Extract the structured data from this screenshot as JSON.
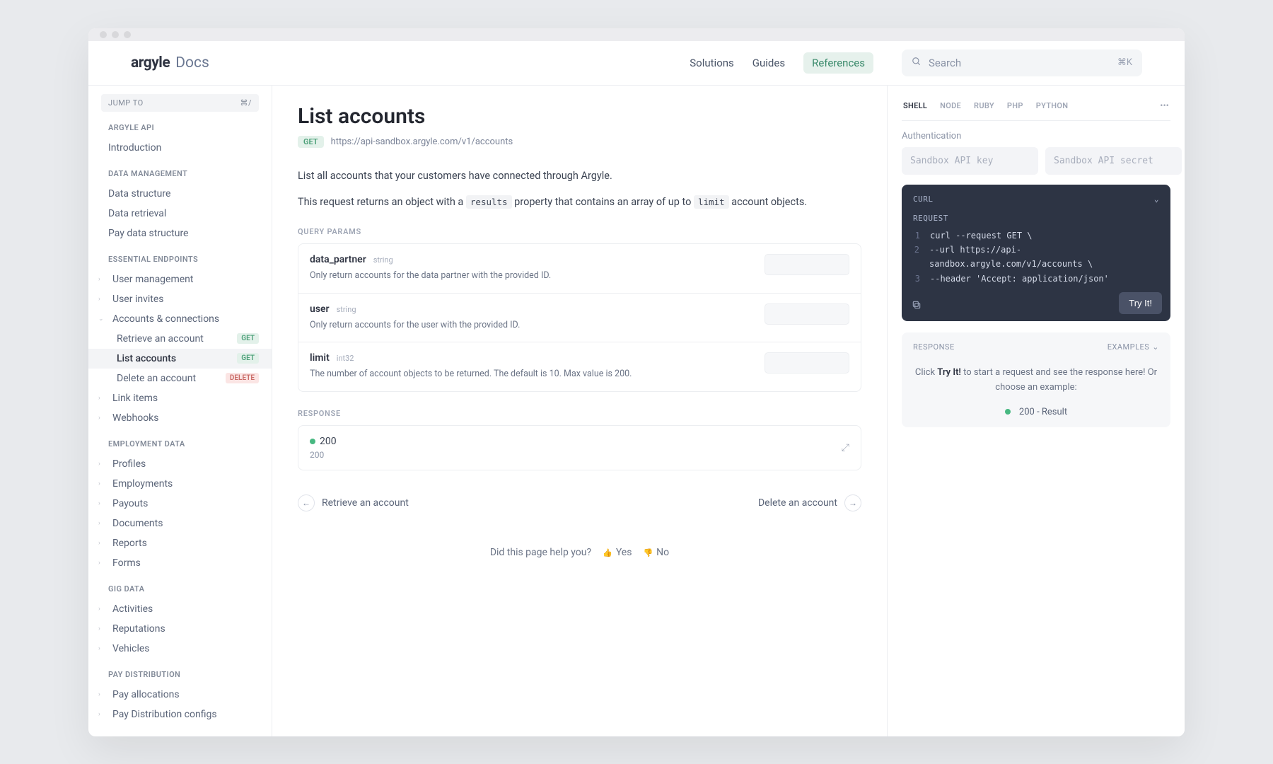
{
  "header": {
    "logo_brand": "argyle",
    "logo_docs": "Docs",
    "nav": [
      "Solutions",
      "Guides",
      "References"
    ],
    "active_nav": 2,
    "search_placeholder": "Search",
    "search_kbd": "⌘K"
  },
  "sidebar": {
    "jump": {
      "label": "JUMP TO",
      "shortcut": "⌘/"
    },
    "sections": [
      {
        "heading": "ARGYLE API",
        "items": [
          {
            "label": "Introduction"
          }
        ]
      },
      {
        "heading": "DATA MANAGEMENT",
        "items": [
          {
            "label": "Data structure"
          },
          {
            "label": "Data retrieval"
          },
          {
            "label": "Pay data structure"
          }
        ]
      },
      {
        "heading": "ESSENTIAL ENDPOINTS",
        "items": [
          {
            "label": "User management",
            "caret": "›"
          },
          {
            "label": "User invites",
            "caret": "›"
          },
          {
            "label": "Accounts & connections",
            "caret": "⌄",
            "children": [
              {
                "label": "Retrieve an account",
                "badge": "GET",
                "badge_kind": "get"
              },
              {
                "label": "List accounts",
                "badge": "GET",
                "badge_kind": "get",
                "active": true
              },
              {
                "label": "Delete an account",
                "badge": "DELETE",
                "badge_kind": "del"
              }
            ]
          },
          {
            "label": "Link items",
            "caret": "›"
          },
          {
            "label": "Webhooks",
            "caret": "›"
          }
        ]
      },
      {
        "heading": "EMPLOYMENT DATA",
        "items": [
          {
            "label": "Profiles",
            "caret": "›"
          },
          {
            "label": "Employments",
            "caret": "›"
          },
          {
            "label": "Payouts",
            "caret": "›"
          },
          {
            "label": "Documents",
            "caret": "›"
          },
          {
            "label": "Reports",
            "caret": "›"
          },
          {
            "label": "Forms",
            "caret": "›"
          }
        ]
      },
      {
        "heading": "GIG DATA",
        "items": [
          {
            "label": "Activities",
            "caret": "›"
          },
          {
            "label": "Reputations",
            "caret": "›"
          },
          {
            "label": "Vehicles",
            "caret": "›"
          }
        ]
      },
      {
        "heading": "PAY DISTRIBUTION",
        "items": [
          {
            "label": "Pay allocations",
            "caret": "›"
          },
          {
            "label": "Pay Distribution configs",
            "caret": "›"
          }
        ]
      }
    ]
  },
  "content": {
    "title": "List accounts",
    "method": "GET",
    "url": "https://api-sandbox.argyle.com/v1/accounts",
    "p1": "List all accounts that your customers have connected through Argyle.",
    "p2_a": "This request returns an object with a ",
    "p2_code1": "results",
    "p2_b": " property that contains an array of up to ",
    "p2_code2": "limit",
    "p2_c": " account objects.",
    "query_label": "QUERY PARAMS",
    "params": [
      {
        "name": "data_partner",
        "type": "string",
        "desc": "Only return accounts for the data partner with the provided ID."
      },
      {
        "name": "user",
        "type": "string",
        "desc": "Only return accounts for the user with the provided ID."
      },
      {
        "name": "limit",
        "type": "int32",
        "desc": "The number of account objects to be returned. The default is 10. Max value is 200."
      }
    ],
    "response_label": "RESPONSE",
    "resp_status": "200",
    "resp_status_text": "200",
    "prev": "Retrieve an account",
    "next": "Delete an account",
    "feedback_q": "Did this page help you?",
    "feedback_yes": "Yes",
    "feedback_no": "No"
  },
  "right": {
    "langs": [
      "SHELL",
      "NODE",
      "RUBY",
      "PHP",
      "PYTHON"
    ],
    "active_lang": 0,
    "auth_label": "Authentication",
    "auth_key_placeholder": "Sandbox API key",
    "auth_secret_placeholder": "Sandbox API secret",
    "code": {
      "header": "CURL",
      "req_label": "REQUEST",
      "lines": [
        {
          "n": "1",
          "t": "curl --request GET \\"
        },
        {
          "n": "2",
          "t": "     --url https://api-sandbox.argyle.com/v1/accounts \\"
        },
        {
          "n": "3",
          "t": "     --header 'Accept: application/json'"
        }
      ],
      "try_label": "Try It!"
    },
    "response": {
      "header": "RESPONSE",
      "examples": "EXAMPLES",
      "hint_a": "Click ",
      "hint_b": "Try It!",
      "hint_c": " to start a request and see the response here! Or choose an example:",
      "example_label": "200 - Result"
    }
  }
}
